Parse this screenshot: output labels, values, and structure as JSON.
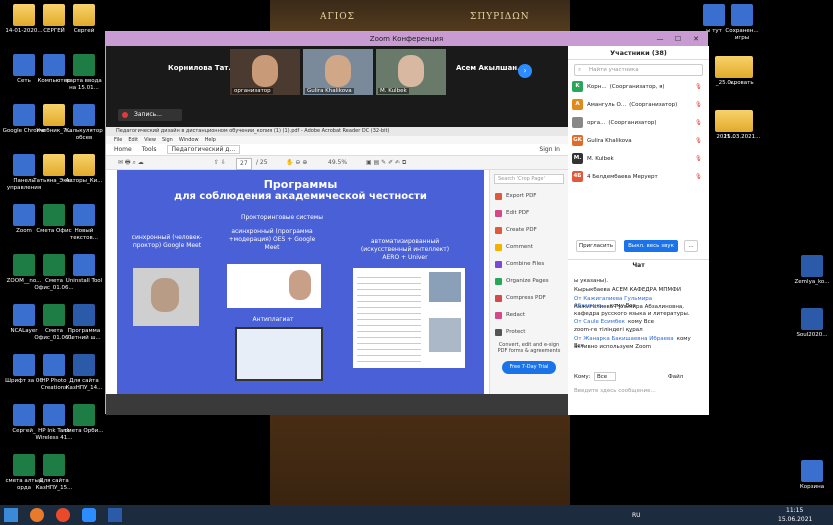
{
  "desktop": {
    "wallpaper_text_left": "ΑΓΙΟΣ",
    "wallpaper_text_right": "ΣΠΥΡΙΔΩΝ",
    "icons_left": [
      {
        "label": "14-01-2020..."
      },
      {
        "label": "СЕРГЕЙ"
      },
      {
        "label": "Сергей"
      },
      {
        "label": "Сеть"
      },
      {
        "label": "Компьютер"
      },
      {
        "label": "карта ввода на 15.01..."
      },
      {
        "label": "Google Chrome"
      },
      {
        "label": "Учебник_7..."
      },
      {
        "label": "Калькулятор обсев"
      },
      {
        "label": "Панель управления"
      },
      {
        "label": "Татьяна_Экз..."
      },
      {
        "label": "Авторы_Ки..."
      },
      {
        "label": "Zoom"
      },
      {
        "label": "Смета Офис"
      },
      {
        "label": "Новый текстов..."
      },
      {
        "label": "ZOOM__no..."
      },
      {
        "label": "Смета Офис_01.06..."
      },
      {
        "label": "Uninstall Tool"
      },
      {
        "label": "NCALayer"
      },
      {
        "label": "Смета Офис_01.06..."
      },
      {
        "label": "Программа Летний ш..."
      },
      {
        "label": "Шрифт за 06"
      },
      {
        "label": "HP Photo Creations"
      },
      {
        "label": "Для сайта КазНПУ_14..."
      },
      {
        "label": "Сергей_"
      },
      {
        "label": "HP Ink Tank Wireless 41..."
      },
      {
        "label": "смета Орби..."
      },
      {
        "label": "смета алтын орда"
      },
      {
        "label": "Для сайта КазНПУ_15..."
      }
    ],
    "icons_right": [
      {
        "label": "Сохранен... игры"
      },
      {
        "label": "_25.0..."
      },
      {
        "label": "кровать"
      },
      {
        "label": "2021..."
      },
      {
        "label": "15.03.2021..."
      },
      {
        "label": "Zemlya_ko..."
      },
      {
        "label": "Soul2020..."
      },
      {
        "label": "Корзина"
      },
      {
        "label": "ы тут"
      }
    ]
  },
  "zoom": {
    "title": "Zoom Конференция",
    "tiles": [
      {
        "name": "Корнилова Тат..."
      },
      {
        "name": "организатор"
      },
      {
        "name": "Gulira Khalikova"
      },
      {
        "name": "M. Kulbek"
      },
      {
        "name": "Асем Акылшан..."
      }
    ],
    "recording_label": "Запись..."
  },
  "acrobat": {
    "title": "Педагогический дизайн в дистанционном обучении_копия (1) (1).pdf - Adobe Acrobat Reader DC (32-bit)",
    "menu": [
      "File",
      "Edit",
      "View",
      "Sign",
      "Window",
      "Help"
    ],
    "tabs": [
      "Home",
      "Tools",
      "Педагогический д..."
    ],
    "sign_in": "Sign In",
    "page_num": "27",
    "page_total": "/ 25",
    "zoom": "49.5%",
    "slide": {
      "title_line1": "Программы",
      "title_line2": "для соблюдения академической честности",
      "sync_label": "синхронный (человек-проктор) Google Meet",
      "proctor_title": "Прокторинговые системы",
      "async_label": "асинхронный (программа +модерация) OES + Google Meet",
      "auto_label": "автоматизированный (искусственный интеллект) AERO + Univer",
      "antiplag": "Антиплагиат"
    },
    "right_panel": {
      "search_placeholder": "Search 'Crop Page'",
      "items": [
        {
          "label": "Export PDF",
          "color": "#e05a3a"
        },
        {
          "label": "Edit PDF",
          "color": "#d44a88"
        },
        {
          "label": "Create PDF",
          "color": "#e05a3a"
        },
        {
          "label": "Comment",
          "color": "#f0b400"
        },
        {
          "label": "Combine Files",
          "color": "#7a4ad4"
        },
        {
          "label": "Organize Pages",
          "color": "#2aa65a"
        },
        {
          "label": "Compress PDF",
          "color": "#d44a4a"
        },
        {
          "label": "Redact",
          "color": "#d44a88"
        },
        {
          "label": "Protect",
          "color": "#555555"
        }
      ],
      "promo": "Convert, edit and e-sign PDF forms & agreements",
      "trial": "Free 7-Day Trial"
    }
  },
  "participants": {
    "header": "Участники (38)",
    "search_placeholder": "Найти участника",
    "list": [
      {
        "initial": "K",
        "name": "Корн...",
        "role": "(Соорганизатор, я)",
        "color": "#2aa65a"
      },
      {
        "initial": "A",
        "name": "Амангуль О...",
        "role": "(Соорганизатор)",
        "color": "#e08a1a"
      },
      {
        "initial": "",
        "name": "орга...",
        "role": "(Соорганизатор)",
        "color": "#888888"
      },
      {
        "initial": "GK",
        "name": "Gulira Khalikova",
        "role": "",
        "color": "#e06a2a"
      },
      {
        "initial": "M.",
        "name": "M. Kulbek",
        "role": "",
        "color": "#333333"
      },
      {
        "initial": "4Б",
        "name": "4 Белдембаева Меруерт",
        "role": "",
        "color": "#e05a3a"
      }
    ],
    "invite": "Пригласить",
    "mute_all": "Выкл. весь звук",
    "more": "..."
  },
  "chat": {
    "header": "Чат",
    "messages": [
      {
        "from": "",
        "to": "",
        "text": "ы указаны)."
      },
      {
        "from": "",
        "to": "",
        "text": "Кырыкбаева АСЕМ КАФЕДРА МПМФИ"
      },
      {
        "from": "От Кажигалиева Гульмира Абзалино...",
        "to": "кому Все",
        "text": "Кажигалиева Гульмира Абзалиновна, кафедра русского языка и литературы."
      },
      {
        "from": "От Саule Есимбек",
        "to": "кому Все",
        "text": "zoom-ге тіліндегі құрал"
      },
      {
        "from": "От Жанарка Бакишаевна Ибраева",
        "to": "кому Все",
        "text": "активно используем Zoom"
      }
    ],
    "to_label": "Кому:",
    "to_value": "Все",
    "file_label": "Файл",
    "input_placeholder": "Введите здесь сообщение..."
  },
  "taskbar": {
    "lang": "RU",
    "time": "11:15",
    "date": "15.06.2021"
  }
}
